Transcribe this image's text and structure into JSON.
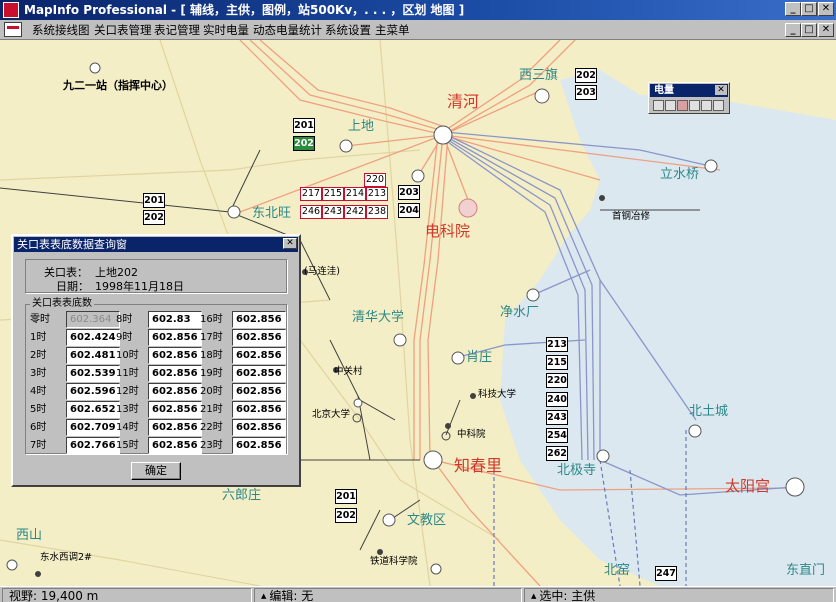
{
  "window": {
    "title": "MapInfo Professional - [ 辅线，主供，图例，站500Kv，. . . ，区划 地图 ]",
    "minimize": "_",
    "restore": "□",
    "close": "✕"
  },
  "menu": {
    "items": [
      "系统接线图",
      "关口表管理",
      "表记管理",
      "实时电量",
      "动态电量统计",
      "系统设置",
      "主菜单"
    ]
  },
  "legend": {
    "title": "电量",
    "close": "✕",
    "icons": [
      "globe-icon",
      "grid-icon",
      "flag-icon",
      "check-icon",
      "table-icon",
      "chart-icon"
    ]
  },
  "map": {
    "places": [
      {
        "text": "清河",
        "style": "red"
      },
      {
        "text": "电科院",
        "style": "red"
      },
      {
        "text": "知春里",
        "style": "red"
      },
      {
        "text": "太阳宫",
        "style": "red"
      },
      {
        "text": "西三旗",
        "style": "cyan"
      },
      {
        "text": "上地",
        "style": "cyan"
      },
      {
        "text": "东北旺",
        "style": "cyan"
      },
      {
        "text": "立水桥",
        "style": "cyan"
      },
      {
        "text": "净水厂",
        "style": "cyan"
      },
      {
        "text": "清华大学",
        "style": "cyan"
      },
      {
        "text": "肖庄",
        "style": "cyan"
      },
      {
        "text": "北土城",
        "style": "cyan"
      },
      {
        "text": "北极寺",
        "style": "cyan"
      },
      {
        "text": "六郎庄",
        "style": "cyan"
      },
      {
        "text": "文教区",
        "style": "cyan"
      },
      {
        "text": "西山",
        "style": "cyan"
      },
      {
        "text": "北窑",
        "style": "cyan"
      },
      {
        "text": "东直门",
        "style": "cyan"
      },
      {
        "text": "九二一站（指挥中心）",
        "style": "bold"
      },
      {
        "text": "首钢冶修",
        "style": "black"
      },
      {
        "text": "(马连洼)",
        "style": "black"
      },
      {
        "text": "中关村",
        "style": "black"
      },
      {
        "text": "北京大学",
        "style": "black"
      },
      {
        "text": "科技大学",
        "style": "black"
      },
      {
        "text": "中科院",
        "style": "black"
      },
      {
        "text": "铁道科学院",
        "style": "black"
      },
      {
        "text": "东水西调2#",
        "style": "black"
      }
    ],
    "meter_ids": [
      "202",
      "203",
      "201",
      "202",
      "201",
      "202",
      "203",
      "204",
      "213",
      "215",
      "220",
      "240",
      "243",
      "254",
      "262",
      "201",
      "202",
      "247"
    ],
    "red_boxes": [
      "220",
      "217",
      "215",
      "214",
      "213",
      "246",
      "243",
      "242",
      "238"
    ]
  },
  "dialog": {
    "title": "关口表表底数据查询窗",
    "close": "✕",
    "meter_label": "关口表：",
    "meter_value": "上地202",
    "date_label": "日期：",
    "date_value": "1998年11月18日",
    "group_title": "关口表表底数",
    "hours": [
      {
        "label": "零时",
        "value": "602.364",
        "disabled": true
      },
      {
        "label": "1时",
        "value": "602.424"
      },
      {
        "label": "2时",
        "value": "602.481"
      },
      {
        "label": "3时",
        "value": "602.539"
      },
      {
        "label": "4时",
        "value": "602.596"
      },
      {
        "label": "5时",
        "value": "602.652"
      },
      {
        "label": "6时",
        "value": "602.709"
      },
      {
        "label": "7时",
        "value": "602.766"
      },
      {
        "label": "8时",
        "value": "602.83"
      },
      {
        "label": "9时",
        "value": "602.856"
      },
      {
        "label": "10时",
        "value": "602.856"
      },
      {
        "label": "11时",
        "value": "602.856"
      },
      {
        "label": "12时",
        "value": "602.856"
      },
      {
        "label": "13时",
        "value": "602.856"
      },
      {
        "label": "14时",
        "value": "602.856"
      },
      {
        "label": "15时",
        "value": "602.856"
      },
      {
        "label": "16时",
        "value": "602.856"
      },
      {
        "label": "17时",
        "value": "602.856"
      },
      {
        "label": "18时",
        "value": "602.856"
      },
      {
        "label": "19时",
        "value": "602.856"
      },
      {
        "label": "20时",
        "value": "602.856"
      },
      {
        "label": "21时",
        "value": "602.856"
      },
      {
        "label": "22时",
        "value": "602.856"
      },
      {
        "label": "23时",
        "value": "602.856"
      }
    ],
    "ok": "确定"
  },
  "status": {
    "zoom": "视野: 19,400 m",
    "edit": "编辑: 无",
    "select": "选中: 主供"
  },
  "colors": {
    "titlebar": "#0a246a",
    "map_land": "#f4eec6",
    "water": "#dbe8f0",
    "orange_line": "#f0a080",
    "blue_line": "#8a96c8",
    "red_label": "#d2382a",
    "cyan_label": "#2c8888"
  }
}
